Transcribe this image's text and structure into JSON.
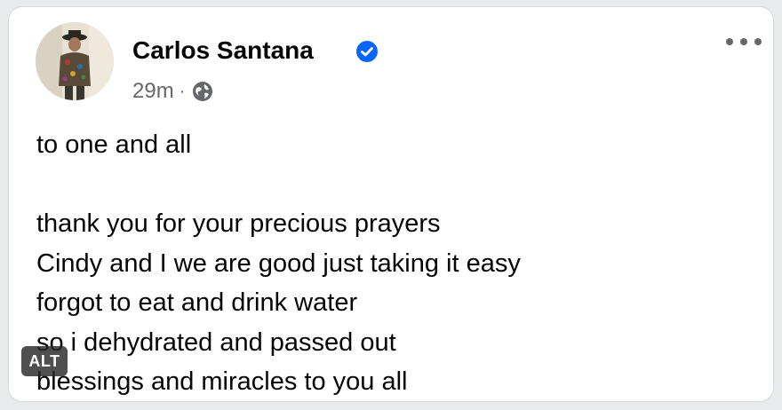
{
  "post": {
    "author": "Carlos Santana",
    "verified": true,
    "timestamp": "29m",
    "separator": "·",
    "audience_icon": "globe-icon",
    "more_icon": "more-options-icon",
    "lines": [
      "to one and all",
      "",
      "thank you for your precious prayers",
      "Cindy and I we are good just taking it easy",
      "forgot to eat and drink water",
      "so i dehydrated and passed out",
      "blessings and miracles to you all"
    ]
  },
  "overlay": {
    "alt_label": "ALT"
  },
  "colors": {
    "verified_blue": "#0866ff",
    "meta_gray": "#65676b",
    "text": "#050505"
  }
}
